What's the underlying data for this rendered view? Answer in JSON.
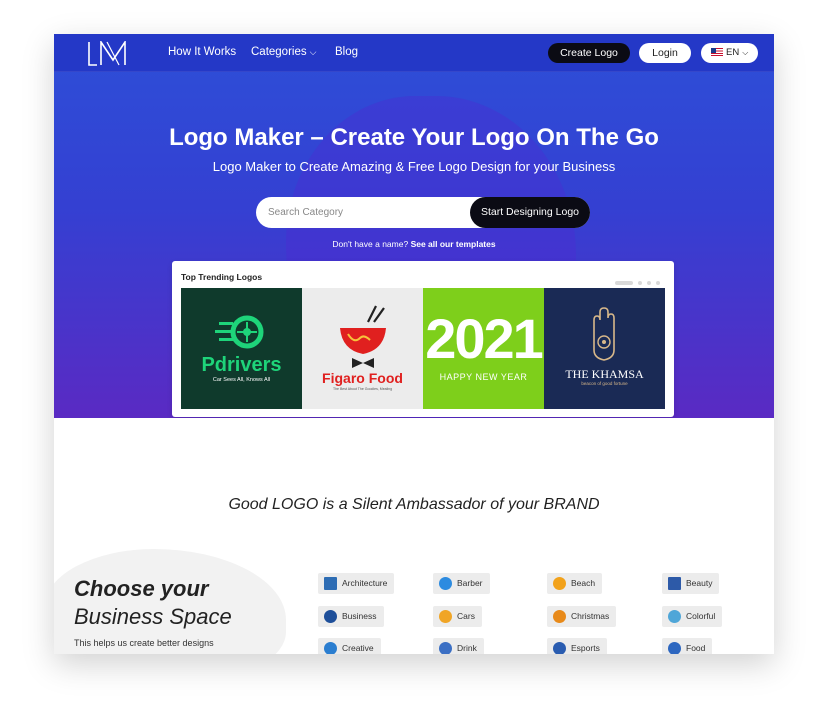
{
  "nav": {
    "brand": "LM",
    "links": [
      "How It Works",
      "Categories",
      "Blog"
    ],
    "create_logo": "Create Logo",
    "login": "Login",
    "language": "EN"
  },
  "hero": {
    "title": "Logo Maker – Create Your Logo On The Go",
    "subtitle": "Logo Maker to Create Amazing & Free Logo Design for your Business",
    "search_placeholder": "Search Category",
    "search_button": "Start Designing Logo",
    "templates_prefix": "Don't have a name?",
    "templates_link": "See all our templates"
  },
  "trending": {
    "title": "Top Trending Logos",
    "logos": [
      {
        "name": "Pdrivers",
        "tagline": "Car Sees All, Knows All",
        "bg": "#0f3a2c",
        "accent": "#1ed47a"
      },
      {
        "name": "Figaro Food",
        "tagline": "The Best About The Goodies, Mealing",
        "bg": "#ececec",
        "accent": "#e0201f"
      },
      {
        "name": "2021",
        "tagline": "HAPPY NEW YEAR",
        "bg": "#7ecf1b",
        "accent": "#ffffff"
      },
      {
        "name": "THE KHAMSA",
        "tagline": "beacon of good fortune",
        "bg": "#1a2a55",
        "accent": "#d8b88a"
      }
    ]
  },
  "section": {
    "headline": "Good LOGO is a Silent Ambassador of your BRAND",
    "choose_line1": "Choose your",
    "choose_line2": "Business Space",
    "choose_desc": "This helps us create better designs"
  },
  "categories": [
    {
      "label": "Architecture",
      "icon": "building-icon",
      "color": "#2e6db4"
    },
    {
      "label": "Barber",
      "icon": "scissors-icon",
      "color": "#2c8be0"
    },
    {
      "label": "Beach",
      "icon": "sun-icon",
      "color": "#f2a21b"
    },
    {
      "label": "Beauty",
      "icon": "bottles-icon",
      "color": "#2d5aa8"
    },
    {
      "label": "Business",
      "icon": "pie-icon",
      "color": "#1e4f9a"
    },
    {
      "label": "Cars",
      "icon": "car-icon",
      "color": "#f0a526"
    },
    {
      "label": "Christmas",
      "icon": "tree-icon",
      "color": "#e88a1a"
    },
    {
      "label": "Colorful",
      "icon": "palette-icon",
      "color": "#4fa6d8"
    },
    {
      "label": "Creative",
      "icon": "bulb-icon",
      "color": "#2b7ed0"
    },
    {
      "label": "Drink",
      "icon": "cup-icon",
      "color": "#3b6fc4"
    },
    {
      "label": "Esports",
      "icon": "gamepad-icon",
      "color": "#2a5cb0"
    },
    {
      "label": "Food",
      "icon": "bowl-icon",
      "color": "#2d67c0"
    }
  ]
}
